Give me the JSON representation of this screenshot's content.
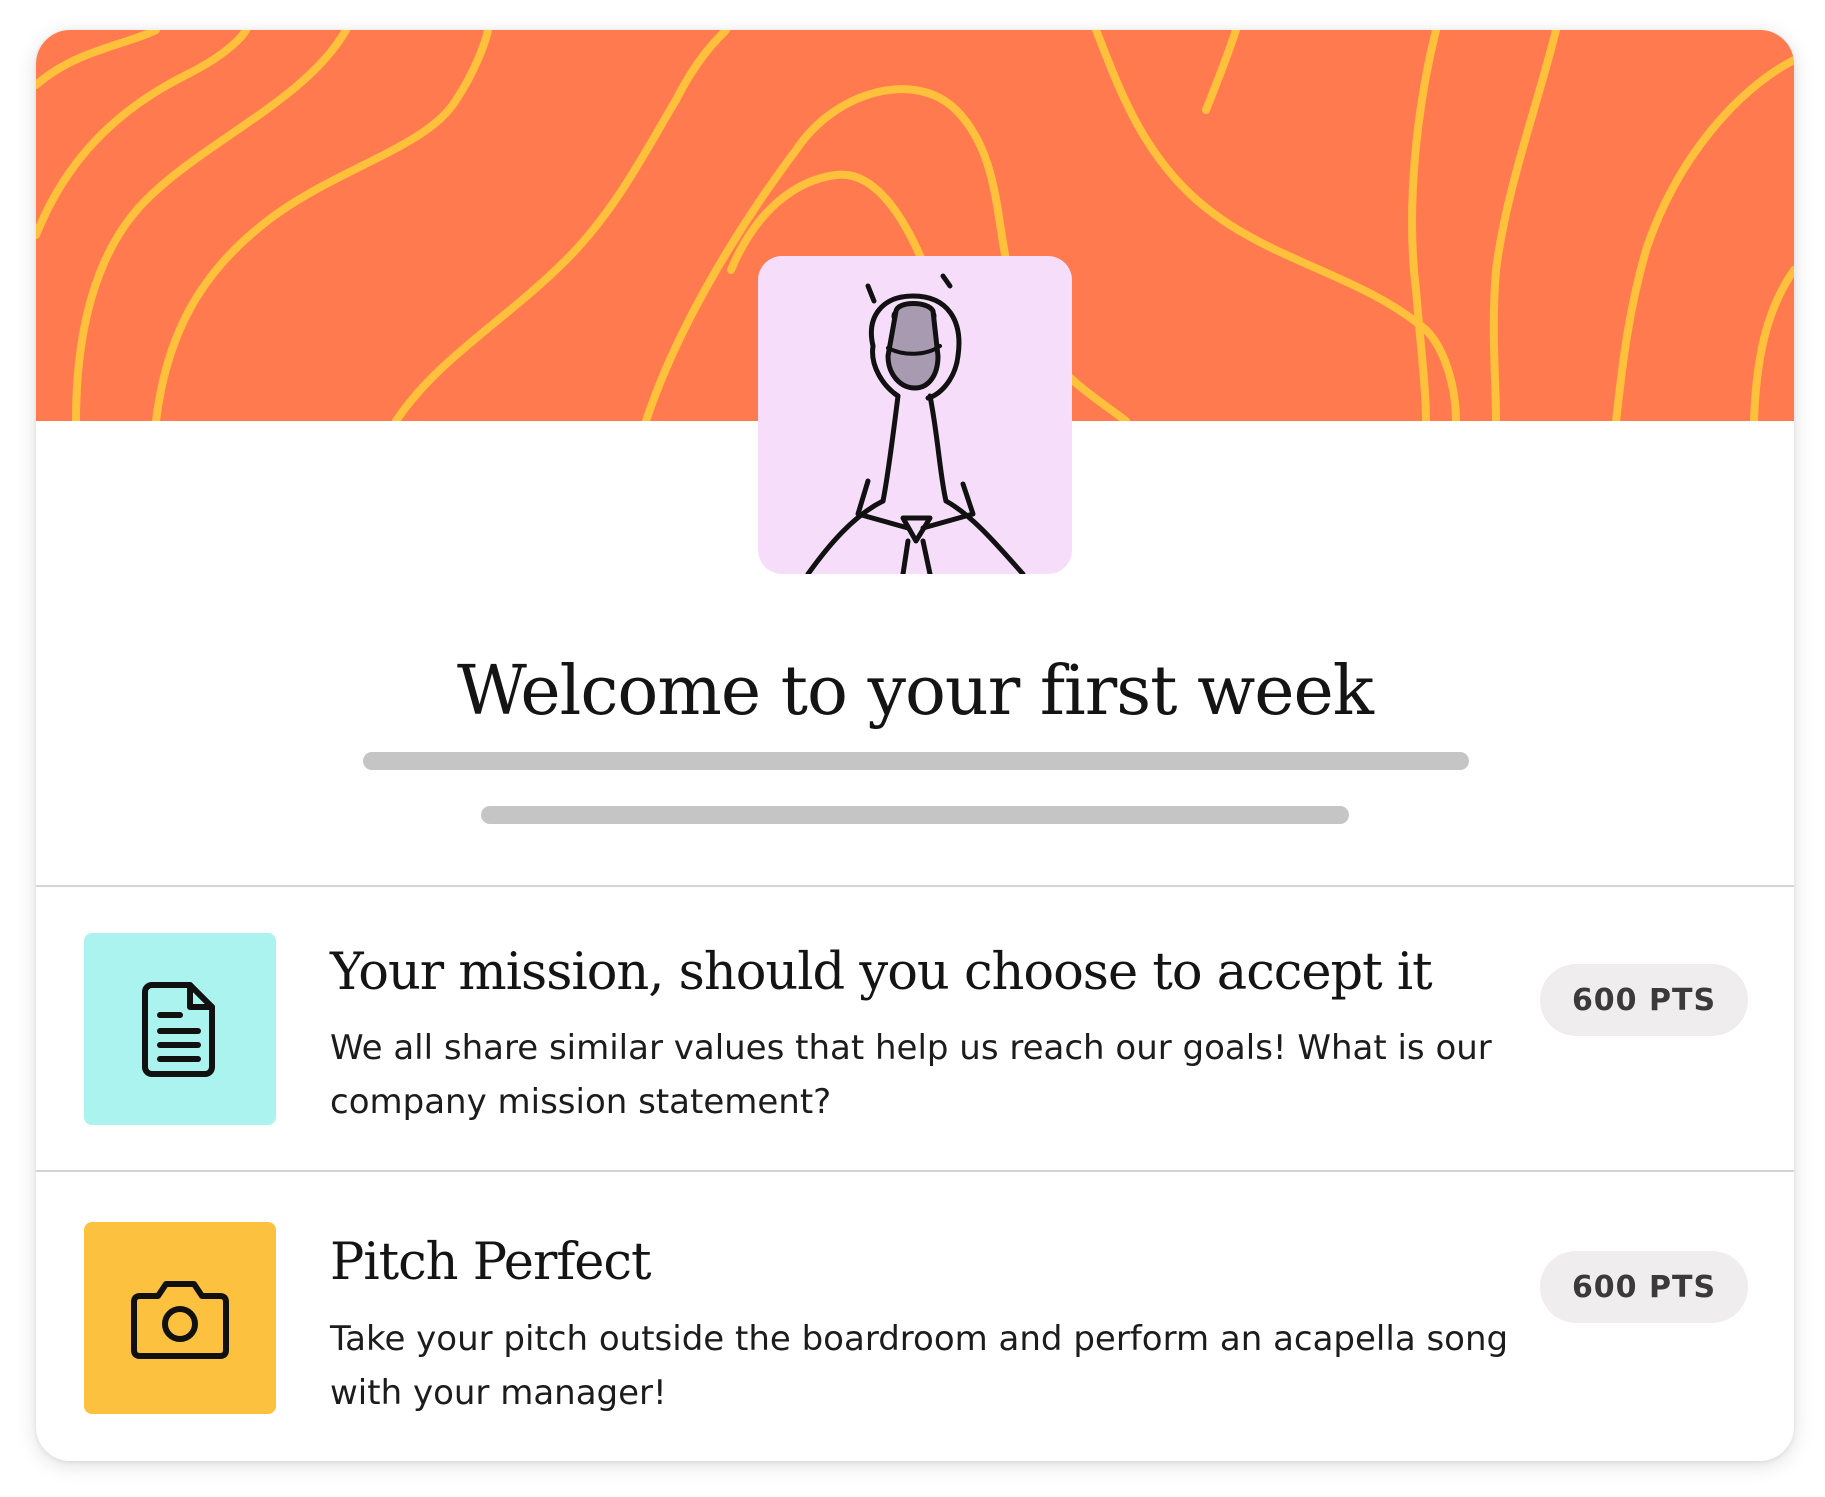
{
  "header": {
    "banner_color": "#ff7b4f",
    "wave_color": "#ffc13b",
    "avatar_bg": "#f6defa",
    "avatar_icon": "goose-with-tie-illustration"
  },
  "welcome": {
    "title": "Welcome to your first week"
  },
  "tasks": [
    {
      "title": "Your mission, should you choose to accept it",
      "description": "We all share similar values that help us reach our goals! What is our company mission statement?",
      "points": "600 PTS",
      "icon": "document-icon",
      "icon_bg": "#aaf3ee"
    },
    {
      "title": "Pitch Perfect",
      "description": "Take your pitch outside the boardroom and perform an acapella song with your manager!",
      "points": "600 PTS",
      "icon": "camera-icon",
      "icon_bg": "#fcc13f"
    }
  ]
}
